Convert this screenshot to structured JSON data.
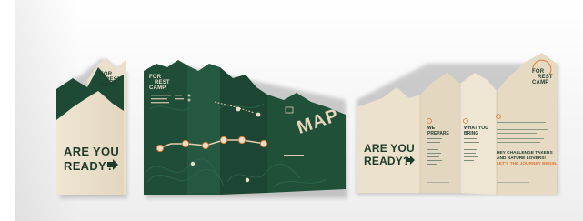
{
  "brand": {
    "logo_line_1": "FOR",
    "logo_line_2": "REST",
    "logo_line_3": "CAMP"
  },
  "cover": {
    "headline_line_1": "ARE YOU",
    "headline_line_2": "READY?"
  },
  "map_panel": {
    "title": "MAP"
  },
  "inside": {
    "headline_line_1": "ARE YOU",
    "headline_line_2": "READY?",
    "column_1_heading_line_1": "WE",
    "column_1_heading_line_2": "PREPARE",
    "column_2_heading_line_1": "WHAT YOU",
    "column_2_heading_line_2": "BRING",
    "challenge_line_1": "HEY CHALLENGE TAKERS",
    "challenge_line_2": "AND NATURE LOVERS!",
    "challenge_line_3": "LET'S THE JOURNEY BEGIN."
  },
  "colors": {
    "forest_green": "#1f4a36",
    "paper_cream": "#eadfca",
    "accent_orange": "#e07a34",
    "text_dark": "#1f3b2c"
  }
}
